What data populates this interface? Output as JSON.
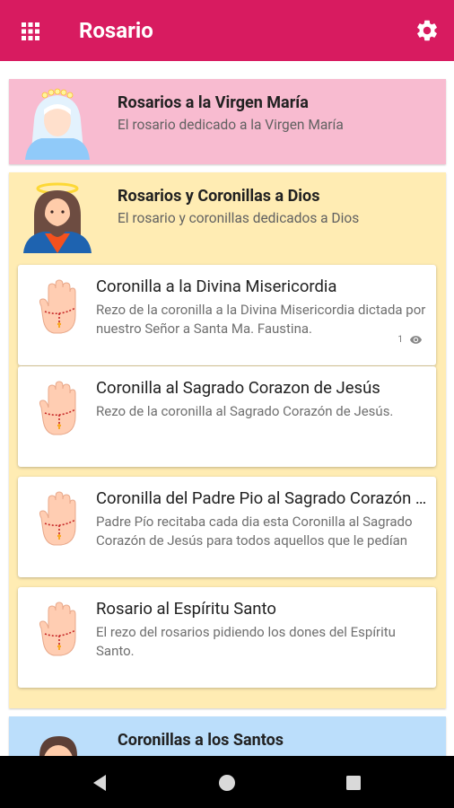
{
  "appbar": {
    "title": "Rosario",
    "menu_icon": "grid-icon",
    "settings_icon": "gear-icon",
    "color": "#D81B60"
  },
  "categories": [
    {
      "title": "Rosarios a la Virgen María",
      "subtitle": "El rosario dedicado a la Virgen María",
      "color": "#F8BBD0"
    },
    {
      "title": "Rosarios y Coronillas a Dios",
      "subtitle": "El rosario  y coronillas dedicados a Dios",
      "color": "#FFECB3"
    },
    {
      "title": "Coronillas a los Santos",
      "color": "#BBDEFB"
    }
  ],
  "items": [
    {
      "title": "Coronilla a la Divina Misericordia",
      "description": "Rezo de la coronilla a la Divina Misericordia dictada por nuestro Señor a Santa Ma. Faustina.",
      "views": "1",
      "views_icon": "eye-icon"
    },
    {
      "title": "Coronilla al Sagrado Corazon de Jesús",
      "description": "Rezo de la coronilla al Sagrado Corazón de Jesús."
    },
    {
      "title": "Coronilla del Padre Pio al Sagrado Corazón de Jesús",
      "description": "Padre Pío recitaba cada dia esta Coronilla al Sagrado Corazón de Jesús para todos aquellos que le pedían sus oraciones."
    },
    {
      "title": "Rosario al Espíritu Santo",
      "description": "El rezo del rosarios pidiendo los dones del Espíritu Santo."
    }
  ],
  "navbar": {
    "back_icon": "back-triangle-icon",
    "home_icon": "home-circle-icon",
    "recents_icon": "recents-square-icon"
  }
}
